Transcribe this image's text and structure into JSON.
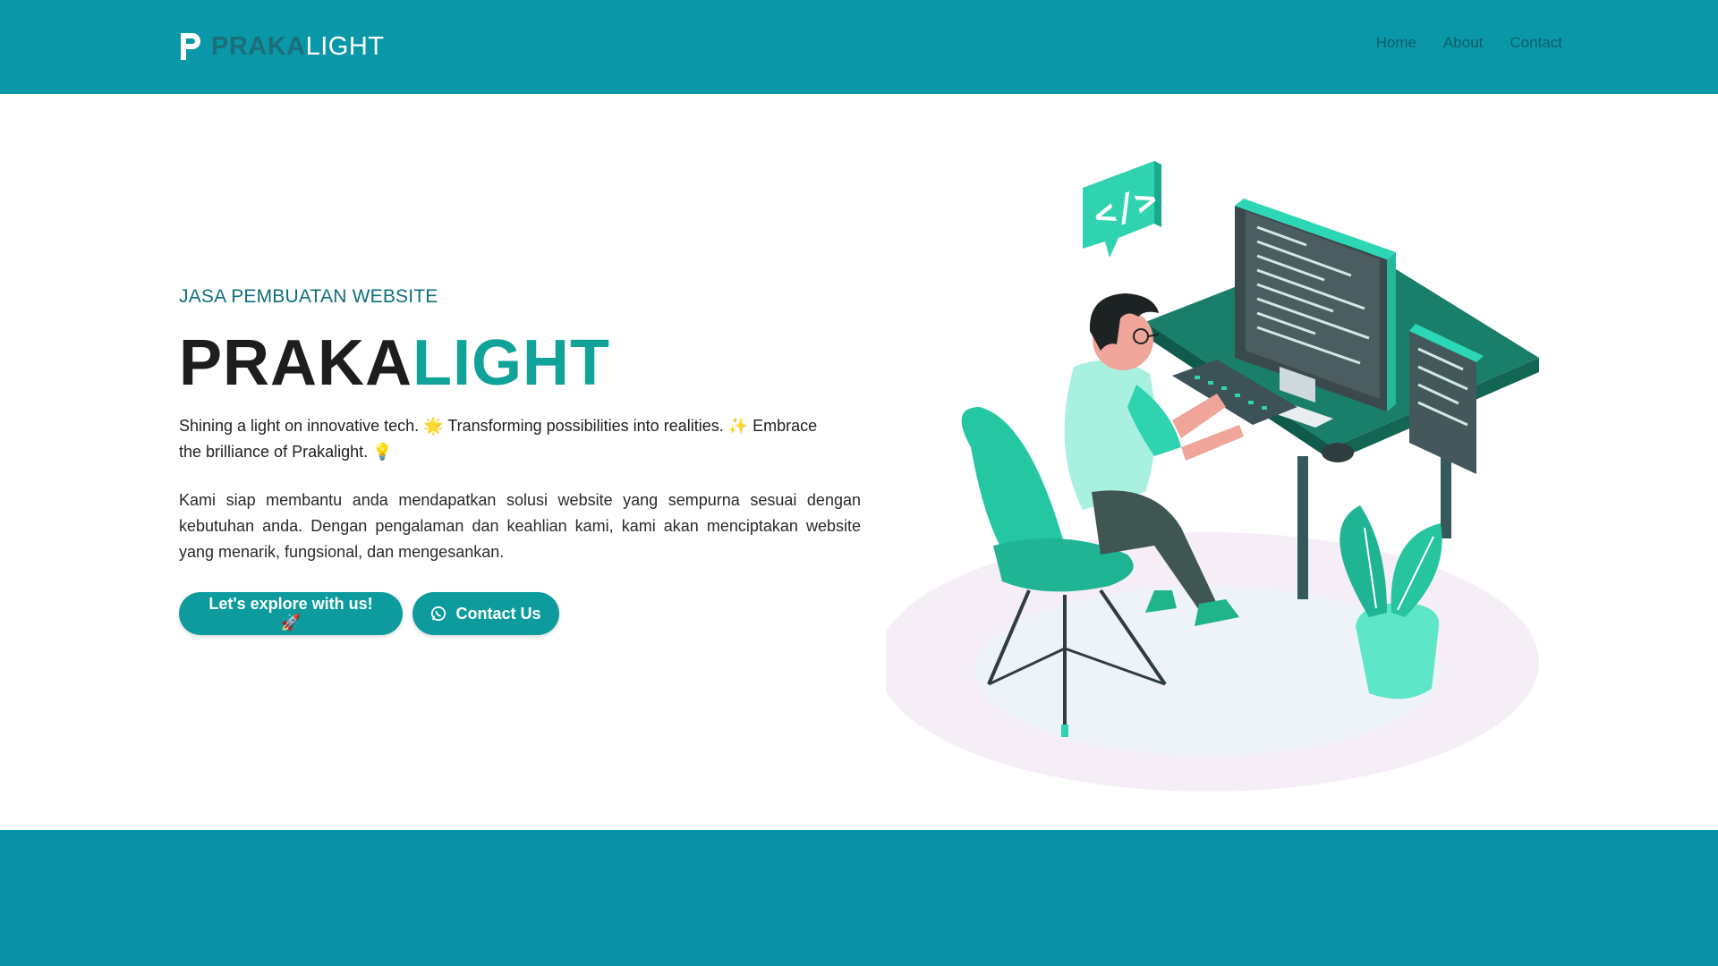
{
  "brand": {
    "prefix": "PRAKA",
    "suffix": "LIGHT",
    "icon": "p-logo-icon"
  },
  "nav": [
    {
      "label": "Home"
    },
    {
      "label": "About"
    },
    {
      "label": "Contact"
    }
  ],
  "hero": {
    "tag": "JASA PEMBUATAN WEBSITE",
    "title_part1": "PRAKA",
    "title_part2": "LIGHT",
    "desc1": "Shining a light on innovative tech. 🌟 Transforming possibilities into realities. ✨ Embrace the brilliance of Prakalight. 💡",
    "desc2": "Kami siap membantu anda mendapatkan solusi website yang sempurna sesuai dengan kebutuhan anda. Dengan pengalaman dan keahlian kami, kami akan menciptakan website yang menarik, fungsional, dan mengesankan.",
    "explore_label": "Let's explore with us! 🚀",
    "contact_label": "Contact Us"
  },
  "colors": {
    "header": "#0a98a8",
    "accent": "#11a39a",
    "button": "#0d9b9e",
    "footer": "#0a92a6"
  },
  "illustration": {
    "icons": [
      "code-bubble-icon",
      "developer-at-desk-illustration",
      "plant-icon"
    ]
  }
}
